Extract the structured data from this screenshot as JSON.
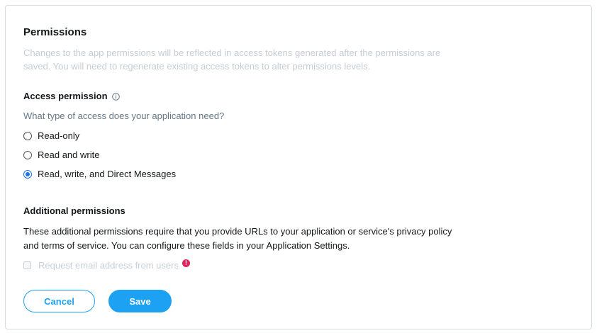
{
  "permissions": {
    "title": "Permissions",
    "description": "Changes to the app permissions will be reflected in access tokens generated after the permissions are saved. You will need to regenerate existing access tokens to alter permissions levels."
  },
  "access": {
    "title": "Access permission",
    "info_icon": "info-circle-icon",
    "question": "What type of access does your application need?",
    "options": [
      {
        "label": "Read-only",
        "checked": false
      },
      {
        "label": "Read and write",
        "checked": false
      },
      {
        "label": "Read, write, and Direct Messages",
        "checked": true
      }
    ]
  },
  "additional": {
    "title": "Additional permissions",
    "description": "These additional permissions require that you provide URLs to your application or service's privacy policy and terms of service. You can configure these fields in your Application Settings.",
    "email_checkbox_label": "Request email address from users",
    "email_checkbox_checked": false,
    "warning_badge": "!"
  },
  "actions": {
    "cancel_label": "Cancel",
    "save_label": "Save"
  },
  "colors": {
    "accent": "#1da1f2",
    "radio_selected": "#1a73e8",
    "warning": "#e0245e",
    "muted_text": "#c4cdd4"
  }
}
